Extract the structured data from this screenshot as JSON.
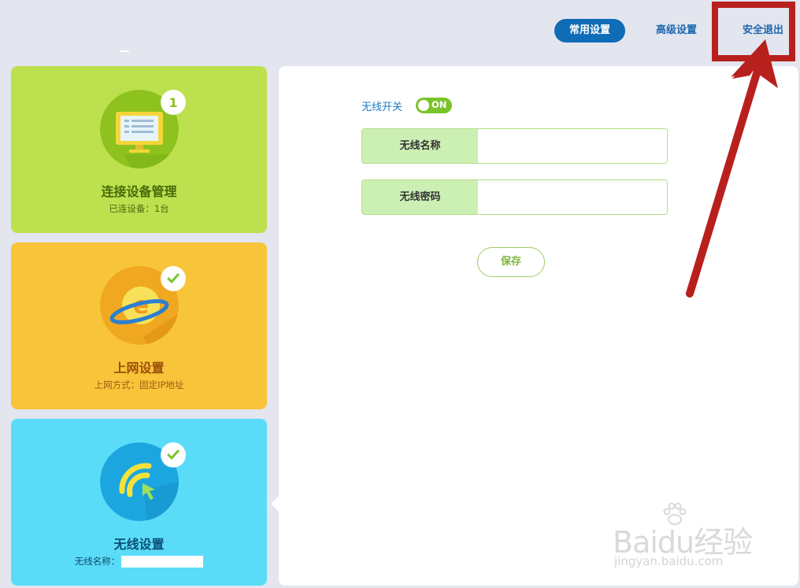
{
  "nav": {
    "common_settings": "常用设置",
    "advanced_settings": "高级设置",
    "logout": "安全退出"
  },
  "cards": {
    "devices": {
      "title": "连接设备管理",
      "subtitle": "已连设备：1台",
      "badge": "1",
      "icon": "monitor-icon"
    },
    "internet": {
      "title": "上网设置",
      "subtitle": "上网方式：固定IP地址",
      "badge_icon": "check-icon",
      "icon": "internet-explorer-icon"
    },
    "wireless": {
      "title": "无线设置",
      "subtitle": "无线名称：",
      "badge_icon": "check-icon",
      "icon": "wifi-icon"
    }
  },
  "form": {
    "wifi_switch_label": "无线开关",
    "wifi_switch_state": "ON",
    "ssid_label": "无线名称",
    "ssid_value": "",
    "password_label": "无线密码",
    "password_value": "",
    "save_label": "保存"
  },
  "watermark": {
    "brand": "Baidu经验",
    "url": "jingyan.baidu.com"
  },
  "colors": {
    "nav_active": "#0f6cb7",
    "devices_card": "#bde04e",
    "internet_card": "#f8c43a",
    "wireless_card": "#5adcf8",
    "toggle_on": "#7ac32a",
    "field_label_bg": "#ccf0b4",
    "annotation_red": "#b8201e"
  }
}
